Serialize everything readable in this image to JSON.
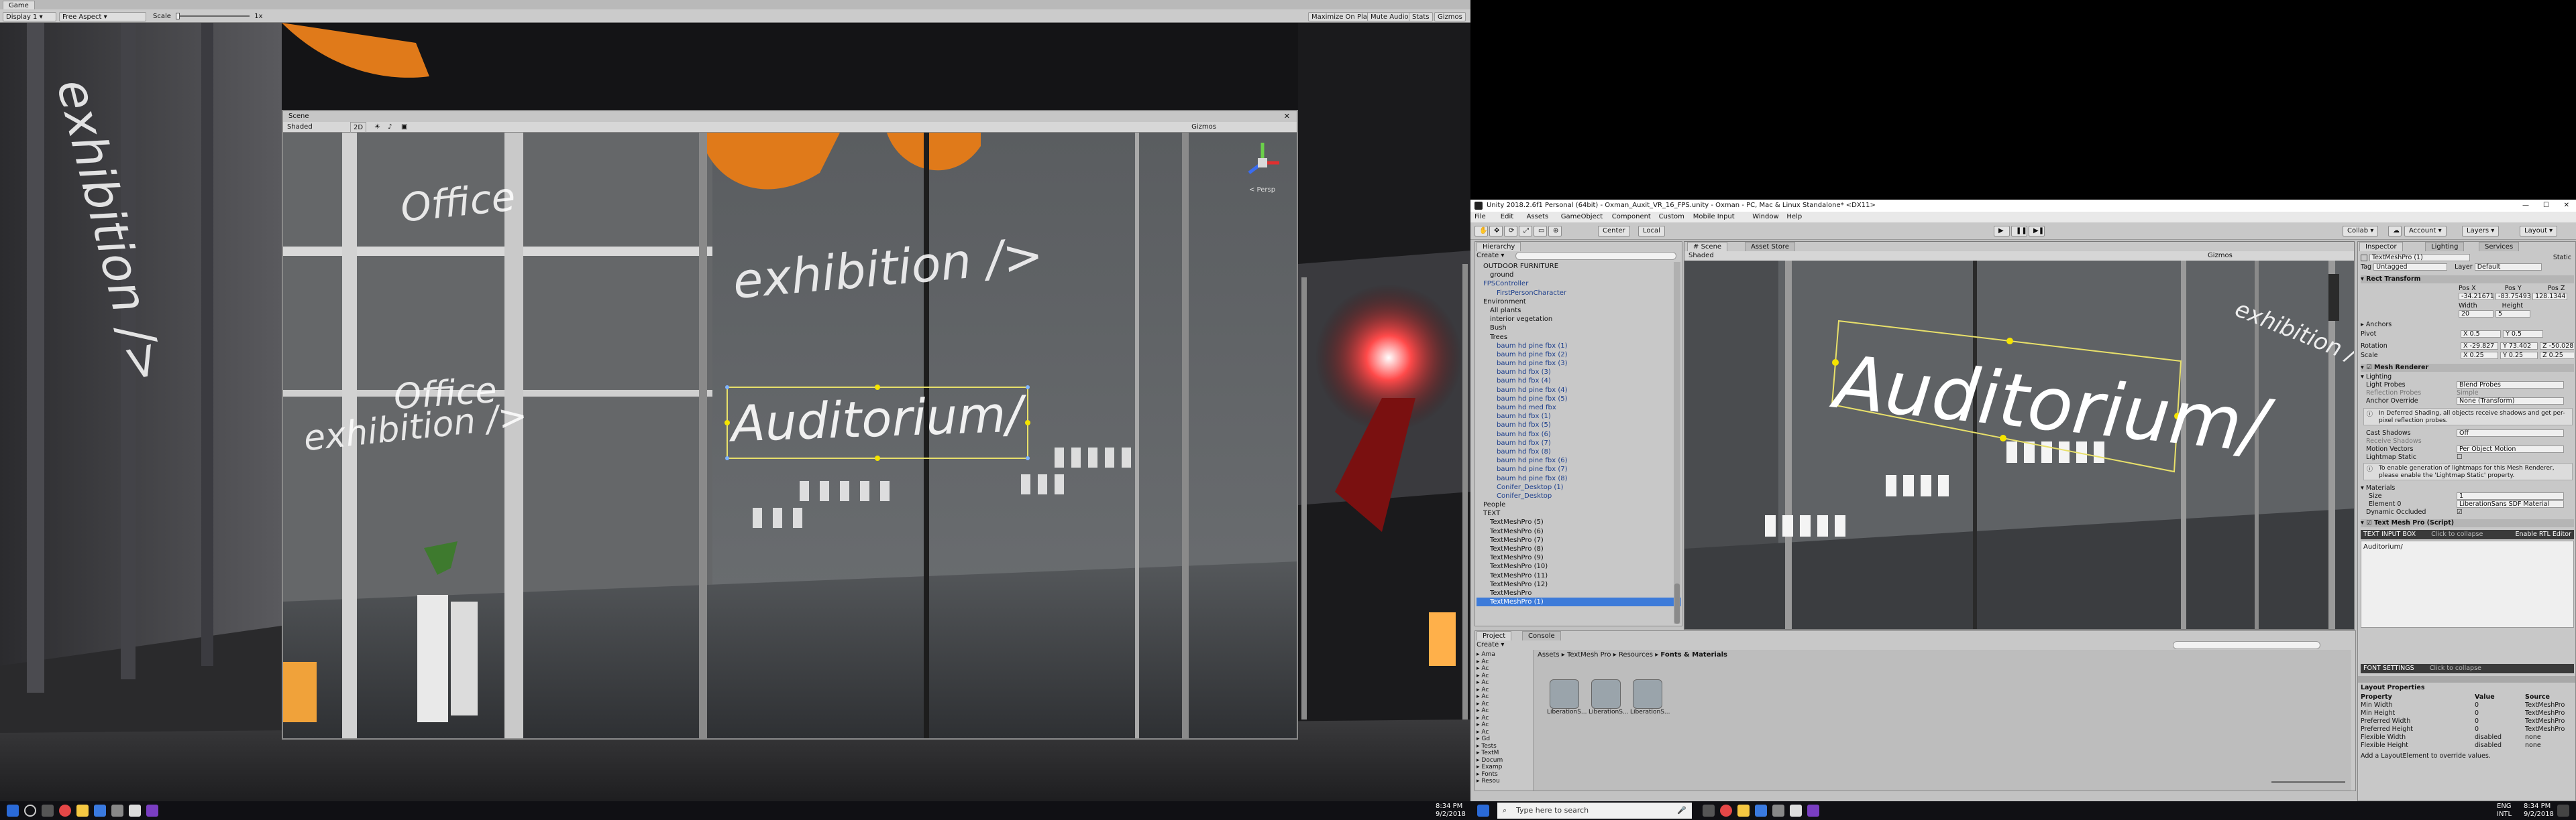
{
  "game": {
    "tab_label": "Game",
    "display_label": "Display 1",
    "aspect_label": "Free Aspect",
    "scale_label": "Scale",
    "scale_value": "1x",
    "maximize_label": "Maximize On Play",
    "mute_label": "Mute Audio",
    "stats_label": "Stats",
    "gizmos_label": "Gizmos"
  },
  "game_signs": {
    "exhibition_side": "exhibition />",
    "office_top": "Office",
    "office_bottom": "Office",
    "exhibition_left": "exhibition />",
    "exhibition_main": "exhibition />",
    "auditorium": "Auditorium/"
  },
  "scene_window": {
    "title": "Scene",
    "shaded_label": "Shaded",
    "mode_2d": "2D",
    "gizmos_label": "Gizmos",
    "persp_label": "< Persp"
  },
  "unity": {
    "title": "Unity 2018.2.6f1 Personal (64bit) - Oxman_Auxit_VR_16_FPS.unity - Oxman - PC, Mac & Linux Standalone* <DX11>",
    "menu": [
      "File",
      "Edit",
      "Assets",
      "GameObject",
      "Component",
      "Custom",
      "Mobile Input",
      "Window",
      "Help"
    ],
    "toolbar": {
      "center_label": "Center",
      "local_label": "Local",
      "collab_label": "Collab",
      "account_label": "Account",
      "layers_label": "Layers",
      "layout_label": "Layout"
    },
    "hierarchy": {
      "tab_label": "Hierarchy",
      "create_label": "Create",
      "items": [
        {
          "label": "OUTDOOR FURNITURE",
          "indent": 1,
          "style": "normal"
        },
        {
          "label": "ground",
          "indent": 2,
          "style": "normal"
        },
        {
          "label": "FPSController",
          "indent": 1,
          "style": "blue"
        },
        {
          "label": "FirstPersonCharacter",
          "indent": 3,
          "style": "blue"
        },
        {
          "label": "Environment",
          "indent": 1,
          "style": "normal"
        },
        {
          "label": "All plants",
          "indent": 2,
          "style": "normal"
        },
        {
          "label": "interior vegetation",
          "indent": 2,
          "style": "normal"
        },
        {
          "label": "Bush",
          "indent": 2,
          "style": "normal"
        },
        {
          "label": "Trees",
          "indent": 2,
          "style": "normal"
        },
        {
          "label": "baum hd pine fbx (1)",
          "indent": 3,
          "style": "blue"
        },
        {
          "label": "baum hd pine fbx (2)",
          "indent": 3,
          "style": "blue"
        },
        {
          "label": "baum hd pine fbx (3)",
          "indent": 3,
          "style": "blue"
        },
        {
          "label": "baum hd fbx (3)",
          "indent": 3,
          "style": "blue"
        },
        {
          "label": "baum hd fbx (4)",
          "indent": 3,
          "style": "blue"
        },
        {
          "label": "baum hd pine fbx (4)",
          "indent": 3,
          "style": "blue"
        },
        {
          "label": "baum hd pine fbx (5)",
          "indent": 3,
          "style": "blue"
        },
        {
          "label": "baum hd med fbx",
          "indent": 3,
          "style": "blue"
        },
        {
          "label": "baum hd fbx (1)",
          "indent": 3,
          "style": "blue"
        },
        {
          "label": "baum hd fbx (5)",
          "indent": 3,
          "style": "blue"
        },
        {
          "label": "baum hd fbx (6)",
          "indent": 3,
          "style": "blue"
        },
        {
          "label": "baum hd fbx (7)",
          "indent": 3,
          "style": "blue"
        },
        {
          "label": "baum hd fbx (8)",
          "indent": 3,
          "style": "blue"
        },
        {
          "label": "baum hd pine fbx (6)",
          "indent": 3,
          "style": "blue"
        },
        {
          "label": "baum hd pine fbx (7)",
          "indent": 3,
          "style": "blue"
        },
        {
          "label": "baum hd pine fbx (8)",
          "indent": 3,
          "style": "blue"
        },
        {
          "label": "Conifer_Desktop (1)",
          "indent": 3,
          "style": "blue"
        },
        {
          "label": "Conifer_Desktop",
          "indent": 3,
          "style": "blue"
        },
        {
          "label": "People",
          "indent": 1,
          "style": "normal"
        },
        {
          "label": "TEXT",
          "indent": 1,
          "style": "normal"
        },
        {
          "label": "TextMeshPro (5)",
          "indent": 2,
          "style": "normal"
        },
        {
          "label": "TextMeshPro (6)",
          "indent": 2,
          "style": "normal"
        },
        {
          "label": "TextMeshPro (7)",
          "indent": 2,
          "style": "normal"
        },
        {
          "label": "TextMeshPro (8)",
          "indent": 2,
          "style": "normal"
        },
        {
          "label": "TextMeshPro (9)",
          "indent": 2,
          "style": "normal"
        },
        {
          "label": "TextMeshPro (10)",
          "indent": 2,
          "style": "normal"
        },
        {
          "label": "TextMeshPro (11)",
          "indent": 2,
          "style": "normal"
        },
        {
          "label": "TextMeshPro (12)",
          "indent": 2,
          "style": "normal"
        },
        {
          "label": "TextMeshPro",
          "indent": 2,
          "style": "normal"
        },
        {
          "label": "TextMeshPro (1)",
          "indent": 2,
          "style": "sel"
        }
      ]
    },
    "scene": {
      "tab_label": "Scene",
      "asset_store_label": "Asset Store",
      "shaded_label": "Shaded",
      "gizmos_label": "Gizmos",
      "sign_main": "Auditorium/",
      "sign_side": "exhibition />"
    },
    "inspector": {
      "tab_label": "Inspector",
      "lighting_tab": "Lighting",
      "services_tab": "Services",
      "object_name": "TextMeshPro (1)",
      "static_label": "Static",
      "tag_label": "Tag",
      "tag_value": "Untagged",
      "layer_label": "Layer",
      "layer_value": "Default",
      "rect_transform": "Rect Transform",
      "pos_x_label": "Pos X",
      "pos_y_label": "Pos Y",
      "pos_z_label": "Pos Z",
      "pos_x": "-34.21671",
      "pos_y": "-83.75493",
      "pos_z": "128.1344",
      "width_label": "Width",
      "height_label": "Height",
      "width": "20",
      "height": "5",
      "anchors_label": "Anchors",
      "pivot_label": "Pivot",
      "pivot_x": "X 0.5",
      "pivot_y": "Y 0.5",
      "rotation_label": "Rotation",
      "rot_x": "X -29.827",
      "rot_y": "Y 73.402",
      "rot_z": "Z -50.028",
      "scale_label": "Scale",
      "scale_x": "X 0.25",
      "scale_y": "Y 0.25",
      "scale_z": "Z 0.25",
      "mesh_renderer": "Mesh Renderer",
      "lighting_label": "Lighting",
      "light_probes_label": "Light Probes",
      "light_probes_value": "Blend Probes",
      "reflection_probes_label": "Reflection Probes",
      "reflection_probes_value": "Simple",
      "anchor_override_label": "Anchor Override",
      "anchor_override_value": "None (Transform)",
      "deferred_note": "In Deferred Shading, all objects receive shadows and get per-pixel reflection probes.",
      "cast_shadows_label": "Cast Shadows",
      "cast_shadows_value": "Off",
      "receive_shadows_label": "Receive Shadows",
      "motion_vectors_label": "Motion Vectors",
      "motion_vectors_value": "Per Object Motion",
      "lightmap_static_label": "Lightmap Static",
      "lightmap_note": "To enable generation of lightmaps for this Mesh Renderer, please enable the 'Lightmap Static' property.",
      "materials_label": "Materials",
      "size_label": "Size",
      "size_value": "1",
      "element0_label": "Element 0",
      "element0_value": "LiberationSans SDF Material",
      "dynamic_occluded_label": "Dynamic Occluded",
      "tmp_script_label": "Text Mesh Pro (Script)",
      "text_input_label": "TEXT INPUT BOX",
      "text_input_hint": "Click to collapse",
      "rtl_label": "Enable RTL Editor",
      "text_value": "Auditorium/",
      "font_settings_label": "FONT SETTINGS",
      "font_settings_hint": "Click to collapse",
      "layout_props_label": "Layout Properties",
      "props_headers": [
        "Property",
        "Value",
        "Source"
      ],
      "props_rows": [
        [
          "Min Width",
          "0",
          "TextMeshPro"
        ],
        [
          "Min Height",
          "0",
          "TextMeshPro"
        ],
        [
          "Preferred Width",
          "0",
          "TextMeshPro"
        ],
        [
          "Preferred Height",
          "0",
          "TextMeshPro"
        ],
        [
          "Flexible Width",
          "disabled",
          "none"
        ],
        [
          "Flexible Height",
          "disabled",
          "none"
        ]
      ],
      "layout_footer": "Add a LayoutElement to override values."
    },
    "project": {
      "tab_label": "Project",
      "console_tab": "Console",
      "create_label": "Create",
      "breadcrumb": [
        "Assets",
        "TextMesh Pro",
        "Resources",
        "Fonts & Materials"
      ],
      "tree_items": [
        "Ama",
        "Ac",
        "Ac",
        "Ac",
        "Ac",
        "Ac",
        "Ac",
        "Ac",
        "Ac",
        "Ac",
        "Ac",
        "Ac",
        "Gd",
        "Tests",
        "TextM",
        "Docum",
        "Examp",
        "Fonts",
        "Resou"
      ],
      "assets": [
        "LiberationS...",
        "LiberationS...",
        "LiberationS..."
      ]
    }
  },
  "taskbar_left": {
    "time": "8:34 PM",
    "date": "9/2/2018"
  },
  "taskbar_right": {
    "search_placeholder": "Type here to search",
    "lang": "ENG",
    "region": "INTL",
    "time": "8:34 PM",
    "date": "9/2/2018"
  }
}
